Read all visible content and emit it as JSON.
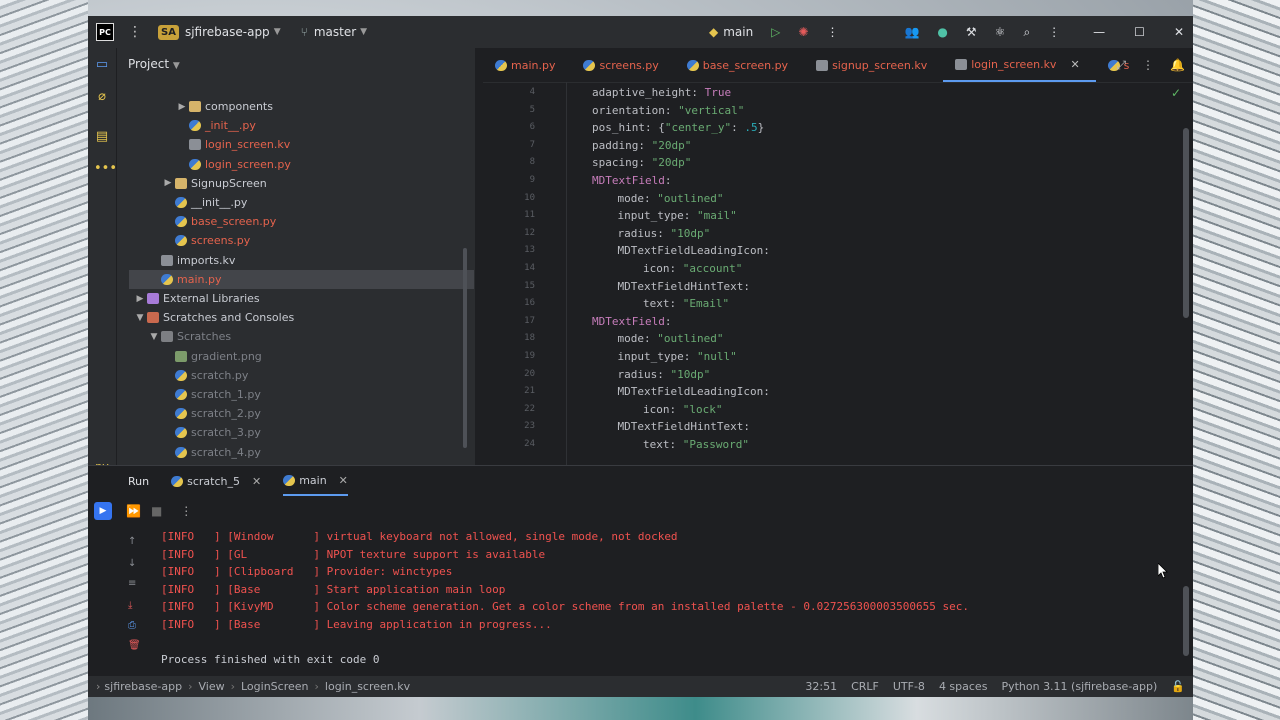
{
  "window": {
    "app_logo": "PC",
    "project_badge": "SA",
    "project_name": "sjfirebase-app",
    "branch": "master",
    "run_config": "main"
  },
  "project_panel": {
    "title": "Project",
    "rows": [
      {
        "label": "components",
        "indent": 4,
        "arrow": "▶",
        "icon": "folder",
        "style": "normal"
      },
      {
        "label": "_init__.py",
        "indent": 4,
        "arrow": "",
        "icon": "py",
        "style": "red"
      },
      {
        "label": "login_screen.kv",
        "indent": 4,
        "arrow": "",
        "icon": "kv",
        "style": "red"
      },
      {
        "label": "login_screen.py",
        "indent": 4,
        "arrow": "",
        "icon": "py",
        "style": "red"
      },
      {
        "label": "SignupScreen",
        "indent": 3,
        "arrow": "▶",
        "icon": "folder",
        "style": "normal"
      },
      {
        "label": "__init__.py",
        "indent": 3,
        "arrow": "",
        "icon": "py",
        "style": "normal"
      },
      {
        "label": "base_screen.py",
        "indent": 3,
        "arrow": "",
        "icon": "py",
        "style": "red"
      },
      {
        "label": "screens.py",
        "indent": 3,
        "arrow": "",
        "icon": "py",
        "style": "red"
      },
      {
        "label": "imports.kv",
        "indent": 2,
        "arrow": "",
        "icon": "kv",
        "style": "normal"
      },
      {
        "label": "main.py",
        "indent": 2,
        "arrow": "",
        "icon": "py",
        "style": "red",
        "selected": true
      },
      {
        "label": "External Libraries",
        "indent": 1,
        "arrow": "▶",
        "icon": "lib",
        "style": "normal"
      },
      {
        "label": "Scratches and Consoles",
        "indent": 1,
        "arrow": "▼",
        "icon": "scr",
        "style": "normal"
      },
      {
        "label": "Scratches",
        "indent": 2,
        "arrow": "▼",
        "icon": "folder-dim",
        "style": "dim"
      },
      {
        "label": "gradient.png",
        "indent": 3,
        "arrow": "",
        "icon": "png",
        "style": "dim"
      },
      {
        "label": "scratch.py",
        "indent": 3,
        "arrow": "",
        "icon": "py",
        "style": "dim"
      },
      {
        "label": "scratch_1.py",
        "indent": 3,
        "arrow": "",
        "icon": "py",
        "style": "dim"
      },
      {
        "label": "scratch_2.py",
        "indent": 3,
        "arrow": "",
        "icon": "py",
        "style": "dim"
      },
      {
        "label": "scratch_3.py",
        "indent": 3,
        "arrow": "",
        "icon": "py",
        "style": "dim"
      },
      {
        "label": "scratch_4.py",
        "indent": 3,
        "arrow": "",
        "icon": "py",
        "style": "dim"
      }
    ]
  },
  "editor": {
    "tabs": [
      {
        "label": "main.py",
        "active": false
      },
      {
        "label": "screens.py",
        "active": false
      },
      {
        "label": "base_screen.py",
        "active": false
      },
      {
        "label": "signup_screen.kv",
        "active": false
      },
      {
        "label": "login_screen.kv",
        "active": true
      },
      {
        "label": "s",
        "active": false
      }
    ],
    "lines": [
      {
        "n": "4",
        "indent": 2,
        "parts": [
          [
            "p",
            "adaptive_height: "
          ],
          [
            "k",
            "True"
          ]
        ]
      },
      {
        "n": "5",
        "indent": 2,
        "parts": [
          [
            "p",
            "orientation: "
          ],
          [
            "s",
            "\"vertical\""
          ]
        ]
      },
      {
        "n": "6",
        "indent": 2,
        "parts": [
          [
            "p",
            "pos_hint: {"
          ],
          [
            "s",
            "\"center_y\""
          ],
          [
            "p",
            ": "
          ],
          [
            "n",
            ".5"
          ],
          [
            "p",
            "}"
          ]
        ]
      },
      {
        "n": "7",
        "indent": 2,
        "parts": [
          [
            "p",
            "padding: "
          ],
          [
            "s",
            "\"20dp\""
          ]
        ]
      },
      {
        "n": "8",
        "indent": 2,
        "parts": [
          [
            "p",
            "spacing: "
          ],
          [
            "s",
            "\"20dp\""
          ]
        ]
      },
      {
        "n": "9",
        "indent": 2,
        "parts": [
          [
            "k",
            "MDTextField"
          ],
          [
            "p",
            ":"
          ]
        ]
      },
      {
        "n": "10",
        "indent": 3,
        "parts": [
          [
            "p",
            "mode: "
          ],
          [
            "s",
            "\"outlined\""
          ]
        ]
      },
      {
        "n": "11",
        "indent": 3,
        "parts": [
          [
            "p",
            "input_type: "
          ],
          [
            "s",
            "\"mail\""
          ]
        ]
      },
      {
        "n": "12",
        "indent": 3,
        "parts": [
          [
            "p",
            "radius: "
          ],
          [
            "s",
            "\"10dp\""
          ]
        ]
      },
      {
        "n": "13",
        "indent": 3,
        "parts": [
          [
            "p",
            "MDTextFieldLeadingIcon:"
          ]
        ]
      },
      {
        "n": "14",
        "indent": 4,
        "parts": [
          [
            "p",
            "icon: "
          ],
          [
            "s",
            "\"account\""
          ]
        ]
      },
      {
        "n": "15",
        "indent": 3,
        "parts": [
          [
            "p",
            "MDTextFieldHintText:"
          ]
        ]
      },
      {
        "n": "16",
        "indent": 4,
        "parts": [
          [
            "p",
            "text: "
          ],
          [
            "s",
            "\"Email\""
          ]
        ]
      },
      {
        "n": "17",
        "indent": 2,
        "parts": [
          [
            "k",
            "MDTextField"
          ],
          [
            "p",
            ":"
          ]
        ]
      },
      {
        "n": "18",
        "indent": 3,
        "parts": [
          [
            "p",
            "mode: "
          ],
          [
            "s",
            "\"outlined\""
          ]
        ]
      },
      {
        "n": "19",
        "indent": 3,
        "parts": [
          [
            "p",
            "input_type: "
          ],
          [
            "s",
            "\"null\""
          ]
        ]
      },
      {
        "n": "20",
        "indent": 3,
        "parts": [
          [
            "p",
            "radius: "
          ],
          [
            "s",
            "\"10dp\""
          ]
        ]
      },
      {
        "n": "21",
        "indent": 3,
        "parts": [
          [
            "p",
            "MDTextFieldLeadingIcon:"
          ]
        ]
      },
      {
        "n": "22",
        "indent": 4,
        "parts": [
          [
            "p",
            "icon: "
          ],
          [
            "s",
            "\"lock\""
          ]
        ]
      },
      {
        "n": "23",
        "indent": 3,
        "parts": [
          [
            "p",
            "MDTextFieldHintText:"
          ]
        ]
      },
      {
        "n": "24",
        "indent": 4,
        "parts": [
          [
            "p",
            "text: "
          ],
          [
            "s",
            "\"Password\""
          ]
        ]
      }
    ]
  },
  "run_panel": {
    "title": "Run",
    "tabs": [
      {
        "label": "scratch_5",
        "active": false
      },
      {
        "label": "main",
        "active": true
      }
    ],
    "console": [
      "[INFO   ] [Window      ] virtual keyboard not allowed, single mode, not docked",
      "[INFO   ] [GL          ] NPOT texture support is available",
      "[INFO   ] [Clipboard   ] Provider: winctypes",
      "[INFO   ] [Base        ] Start application main loop",
      "[INFO   ] [KivyMD      ] Color scheme generation. Get a color scheme from an installed palette - 0.027256300003500655 sec.",
      "[INFO   ] [Base        ] Leaving application in progress...",
      "",
      "Process finished with exit code 0"
    ]
  },
  "status_bar": {
    "breadcrumb": [
      "sjfirebase-app",
      "View",
      "LoginScreen",
      "login_screen.kv"
    ],
    "position": "32:51",
    "line_sep": "CRLF",
    "encoding": "UTF-8",
    "indent": "4 spaces",
    "interpreter": "Python 3.11 (sjfirebase-app)"
  }
}
